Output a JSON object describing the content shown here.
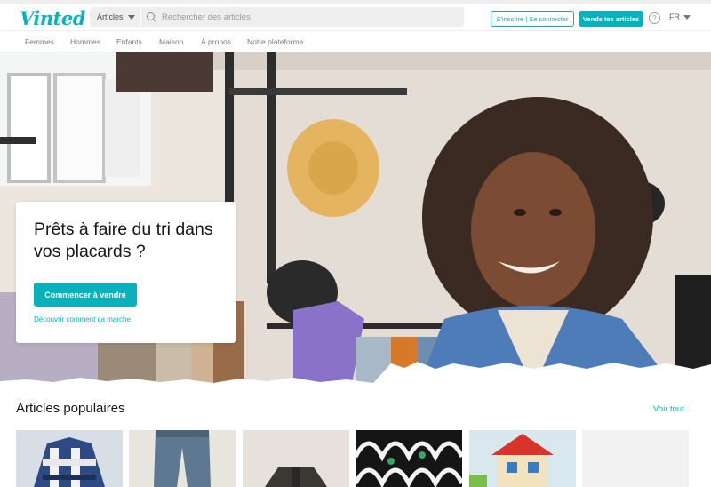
{
  "header": {
    "logo": "Vinted",
    "category": "Articles",
    "search_placeholder": "Rechercher des articles",
    "signup_label": "S'inscrire | Se connecter",
    "sell_label": "Vends tes articles",
    "help_symbol": "?",
    "language": "FR"
  },
  "nav": {
    "items": [
      "Femmes",
      "Hommes",
      "Enfants",
      "Maison",
      "À propos",
      "Notre plateforme"
    ]
  },
  "hero": {
    "title": "Prêts à faire du tri dans vos placards ?",
    "cta_label": "Commencer à vendre",
    "link_label": "Découvrir comment ça marche"
  },
  "popular": {
    "title": "Articles populaires",
    "see_all": "Voir tout",
    "items": [
      "plaid-shirt",
      "jeans",
      "jacket",
      "patterned-garment",
      "toy-house",
      "placeholder"
    ]
  },
  "colors": {
    "brand": "#09b1ba",
    "text": "#171717",
    "muted": "#7a7a7a"
  }
}
